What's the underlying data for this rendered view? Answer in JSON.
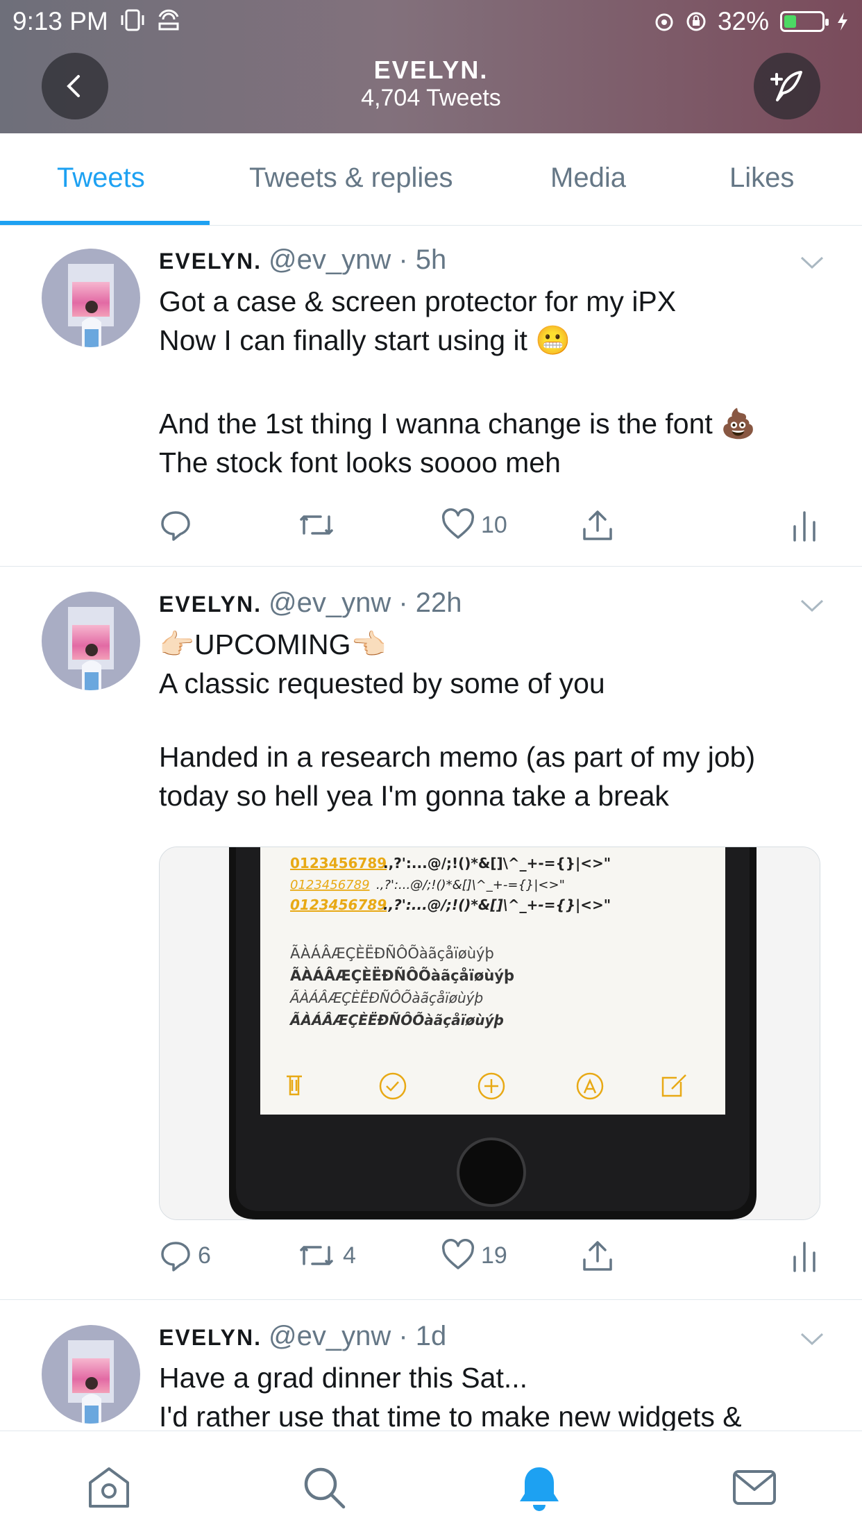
{
  "status_bar": {
    "time": "9:13 PM",
    "battery": "32%",
    "battery_level": 0.32
  },
  "header": {
    "title": "EVELYN.",
    "subtitle": "4,704 Tweets"
  },
  "tabs": [
    {
      "label": "Tweets",
      "active": true
    },
    {
      "label": "Tweets & replies",
      "active": false
    },
    {
      "label": "Media",
      "active": false
    },
    {
      "label": "Likes",
      "active": false
    }
  ],
  "colors": {
    "accent": "#1da1f2",
    "text": "#14171a",
    "muted": "#657786",
    "like": "#657786"
  },
  "tweets": [
    {
      "name": "EVELYN.",
      "handle": "@ev_ynw",
      "time": "· 5h",
      "lines": [
        "Got a case & screen protector for my iPX",
        "Now I can finally start using it 😬",
        "",
        "And the 1st thing I wanna change is the font 💩",
        "The stock font looks soooo meh"
      ],
      "replies": "",
      "retweets": "",
      "likes": "10"
    },
    {
      "name": "EVELYN.",
      "handle": "@ev_ynw",
      "time": "· 22h",
      "lines": [
        "👉🏻UPCOMING👈🏻",
        "A classic requested by some of you",
        "",
        "Handed in a research memo (as part of my job)",
        "today so hell yea I'm gonna take a break"
      ],
      "media": {
        "digits": "0123456789",
        "symbols": ".,?':...@/;!()*&[]\\^_+-={}|<>\"",
        "accents": "ÃÀÁÂÆÇÈËÐÑÔÕàãçåïøùýþ"
      },
      "replies": "6",
      "retweets": "4",
      "likes": "19"
    },
    {
      "name": "EVELYN.",
      "handle": "@ev_ynw",
      "time": "· 1d",
      "lines": [
        "Have a grad dinner this Sat...",
        "I'd rather use that time to make new widgets &"
      ]
    }
  ]
}
